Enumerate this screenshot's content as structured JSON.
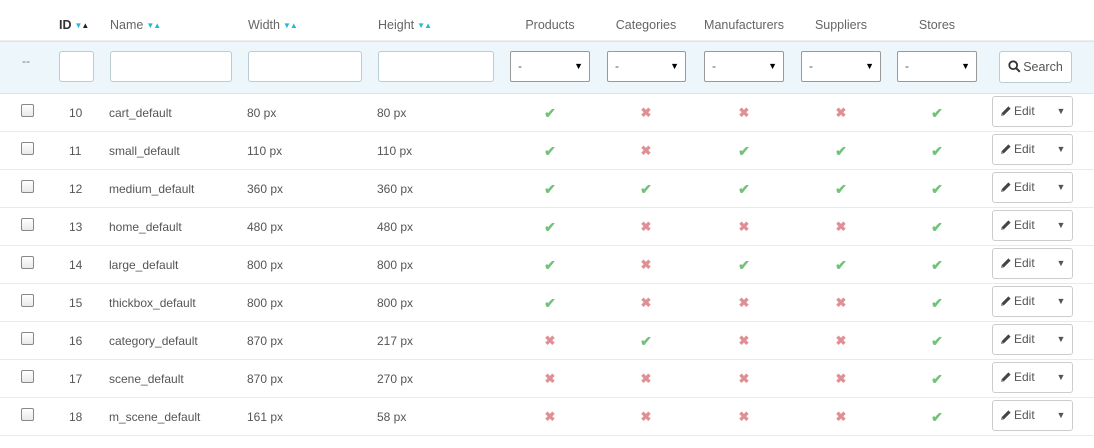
{
  "columns": {
    "id": "ID",
    "name": "Name",
    "width": "Width",
    "height": "Height",
    "products": "Products",
    "categories": "Categories",
    "manufacturers": "Manufacturers",
    "suppliers": "Suppliers",
    "stores": "Stores"
  },
  "filters": {
    "bulk_placeholder": "--",
    "products": "-",
    "categories": "-",
    "manufacturers": "-",
    "suppliers": "-",
    "stores": "-",
    "search_label": "Search"
  },
  "actions": {
    "edit_label": "Edit"
  },
  "colors": {
    "ok": "#72c279",
    "ko": "#e08f95",
    "accent": "#25b9d7",
    "filter_bg": "#ecf6fb"
  },
  "rows": [
    {
      "id": "10",
      "name": "cart_default",
      "width": "80 px",
      "height": "80 px",
      "products": true,
      "categories": false,
      "manufacturers": false,
      "suppliers": false,
      "stores": true
    },
    {
      "id": "11",
      "name": "small_default",
      "width": "110 px",
      "height": "110 px",
      "products": true,
      "categories": false,
      "manufacturers": true,
      "suppliers": true,
      "stores": true
    },
    {
      "id": "12",
      "name": "medium_default",
      "width": "360 px",
      "height": "360 px",
      "products": true,
      "categories": true,
      "manufacturers": true,
      "suppliers": true,
      "stores": true
    },
    {
      "id": "13",
      "name": "home_default",
      "width": "480 px",
      "height": "480 px",
      "products": true,
      "categories": false,
      "manufacturers": false,
      "suppliers": false,
      "stores": true
    },
    {
      "id": "14",
      "name": "large_default",
      "width": "800 px",
      "height": "800 px",
      "products": true,
      "categories": false,
      "manufacturers": true,
      "suppliers": true,
      "stores": true
    },
    {
      "id": "15",
      "name": "thickbox_default",
      "width": "800 px",
      "height": "800 px",
      "products": true,
      "categories": false,
      "manufacturers": false,
      "suppliers": false,
      "stores": true
    },
    {
      "id": "16",
      "name": "category_default",
      "width": "870 px",
      "height": "217 px",
      "products": false,
      "categories": true,
      "manufacturers": false,
      "suppliers": false,
      "stores": true
    },
    {
      "id": "17",
      "name": "scene_default",
      "width": "870 px",
      "height": "270 px",
      "products": false,
      "categories": false,
      "manufacturers": false,
      "suppliers": false,
      "stores": true
    },
    {
      "id": "18",
      "name": "m_scene_default",
      "width": "161 px",
      "height": "58 px",
      "products": false,
      "categories": false,
      "manufacturers": false,
      "suppliers": false,
      "stores": true
    }
  ]
}
